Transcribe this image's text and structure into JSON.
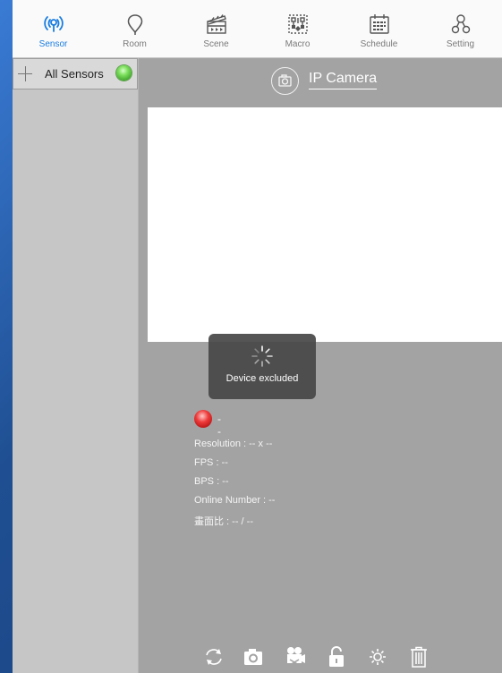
{
  "tabs": [
    {
      "label": "Sensor",
      "icon": "sensor-icon",
      "active": true
    },
    {
      "label": "Room",
      "icon": "room-pin-icon",
      "active": false
    },
    {
      "label": "Scene",
      "icon": "clapperboard-icon",
      "active": false
    },
    {
      "label": "Macro",
      "icon": "macro-flow-icon",
      "active": false
    },
    {
      "label": "Schedule",
      "icon": "calendar-icon",
      "active": false
    },
    {
      "label": "Setting",
      "icon": "setting-nodes-icon",
      "active": false
    }
  ],
  "sidebar": {
    "item_label": "All Sensors",
    "status_color": "#5cc941"
  },
  "camera": {
    "title": "IP Camera",
    "toast_text": "Device excluded",
    "status_text": "--",
    "status_color": "#e63b3b",
    "info": {
      "resolution": "Resolution : -- x --",
      "fps": "FPS : --",
      "bps": "BPS : --",
      "online": "Online Number : --",
      "ratio": "畫面比 : -- / --"
    }
  },
  "toolbar": {
    "buttons": [
      "refresh-icon",
      "snapshot-icon",
      "record-video-icon",
      "unlock-icon",
      "settings-gear-icon",
      "trash-icon"
    ]
  },
  "colors": {
    "accent": "#1a7de0",
    "panel": "#a3a3a3",
    "sidebar": "#c6c6c6"
  }
}
